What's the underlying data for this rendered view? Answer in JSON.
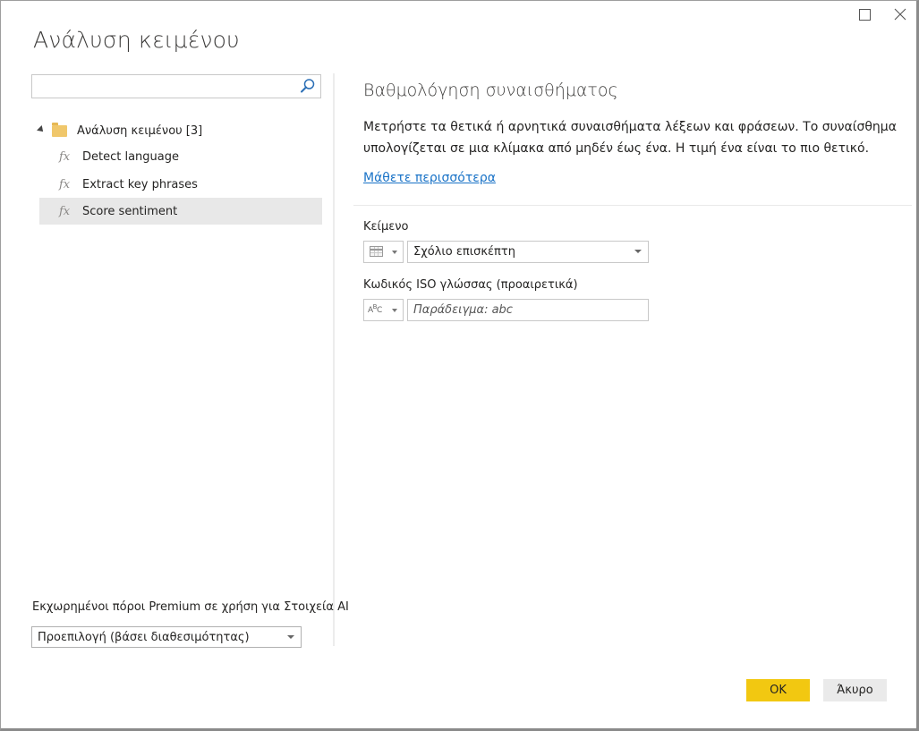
{
  "window": {
    "title": "Ανάλυση κειμένου",
    "controls": {
      "maximize_icon": "maximize-icon",
      "close_icon": "close-icon"
    }
  },
  "sidebar": {
    "search": {
      "value": "",
      "placeholder": "",
      "icon": "search-icon"
    },
    "tree": {
      "group_label": "Ανάλυση κειμένου [3]",
      "group_icon": "folder-icon",
      "items": [
        {
          "label": "Detect language",
          "icon": "function-icon",
          "selected": false
        },
        {
          "label": "Extract key phrases",
          "icon": "function-icon",
          "selected": false
        },
        {
          "label": "Score sentiment",
          "icon": "function-icon",
          "selected": true
        }
      ]
    },
    "premium": {
      "label": "Εκχωρημένοι πόροι Premium σε χρήση για Στοιχεία AI",
      "selected_value": "Προεπιλογή (βάσει διαθεσιμότητας)"
    }
  },
  "main": {
    "section_title": "Βαθμολόγηση συναισθήματος",
    "description": "Μετρήστε τα θετικά ή αρνητικά συναισθήματα λέξεων και φράσεων. Το συναίσθημα υπολογίζεται σε μια κλίμακα από μηδέν έως ένα. Η τιμή ένα είναι το πιο θετικό.",
    "learn_more": "Μάθετε περισσότερα",
    "fields": [
      {
        "label": "Κείμενο",
        "type_icon": "table-column-icon",
        "value": "Σχόλιο επισκέπτη"
      },
      {
        "label": "Κωδικός ISO γλώσσας (προαιρετικά)",
        "type_icon": "text-type-icon",
        "type_icon_text": "ABC",
        "value": "",
        "placeholder": "Παράδειγμα: abc"
      }
    ]
  },
  "footer": {
    "ok_label": "OK",
    "cancel_label": "Άκυρο",
    "accent_color": "#F2C811"
  }
}
